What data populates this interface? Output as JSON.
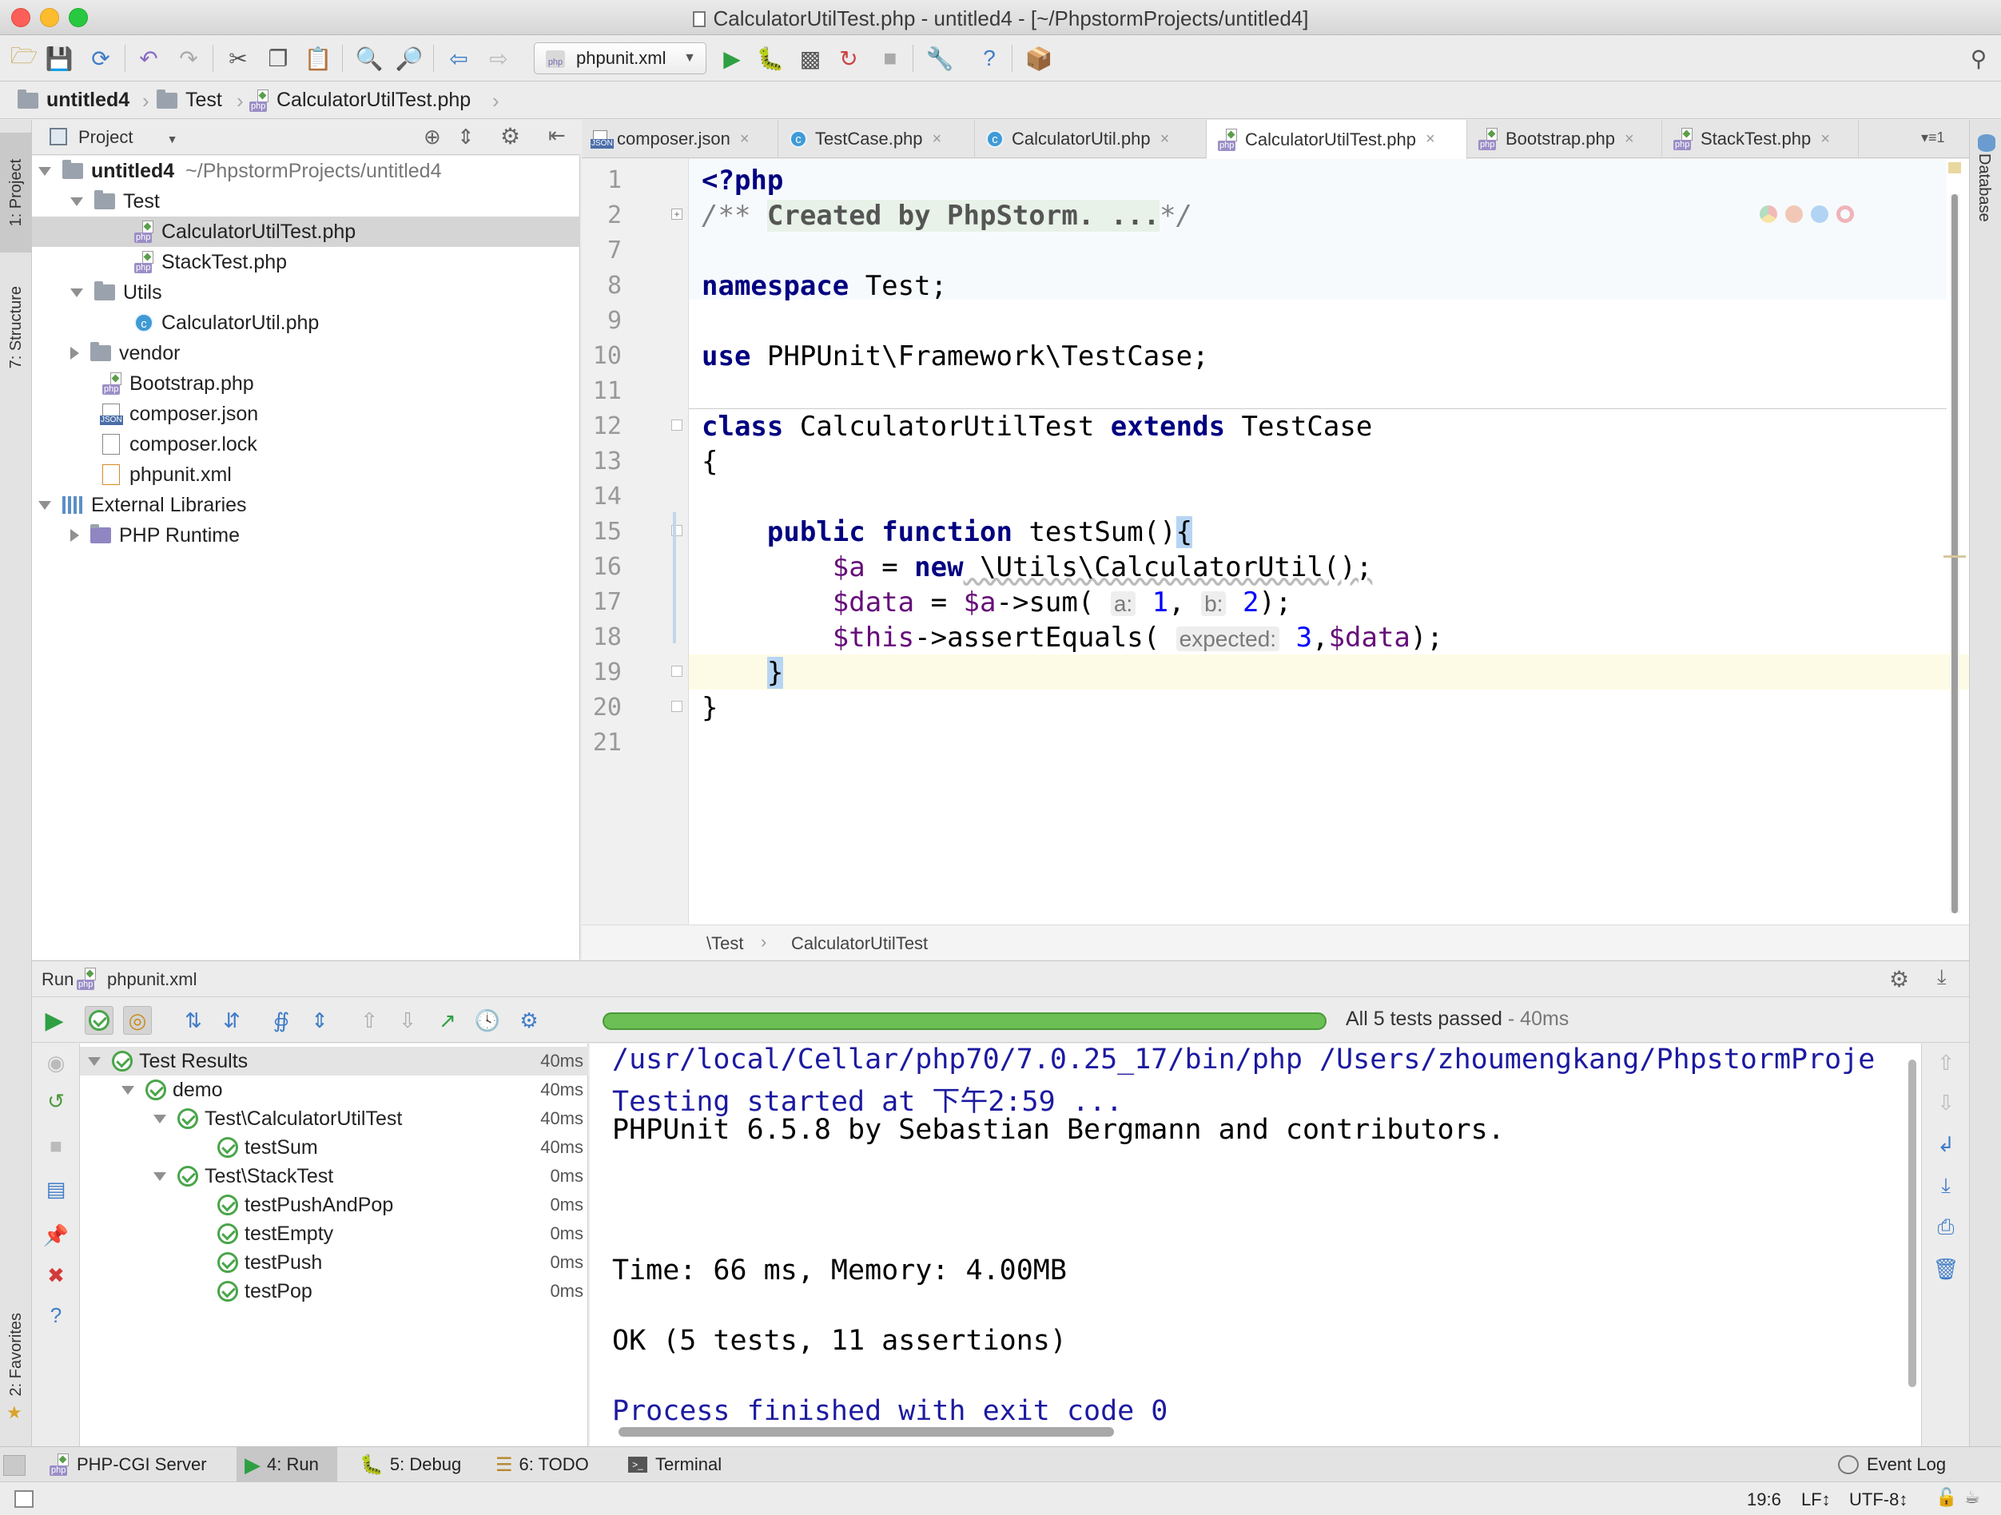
{
  "window": {
    "title": "CalculatorUtilTest.php - untitled4 - [~/PhpstormProjects/untitled4]"
  },
  "toolbar": {
    "run_config": "phpunit.xml"
  },
  "breadcrumbs": [
    "untitled4",
    "Test",
    "CalculatorUtilTest.php"
  ],
  "left_tool_tabs": [
    "1: Project",
    "7: Structure",
    "2: Favorites"
  ],
  "right_tool_tabs": [
    "Database"
  ],
  "project": {
    "header": "Project",
    "tree": [
      {
        "label": "untitled4",
        "suffix": "~/PhpstormProjects/untitled4"
      },
      {
        "label": "Test"
      },
      {
        "label": "CalculatorUtilTest.php"
      },
      {
        "label": "StackTest.php"
      },
      {
        "label": "Utils"
      },
      {
        "label": "CalculatorUtil.php"
      },
      {
        "label": "vendor"
      },
      {
        "label": "Bootstrap.php"
      },
      {
        "label": "composer.json"
      },
      {
        "label": "composer.lock"
      },
      {
        "label": "phpunit.xml"
      },
      {
        "label": "External Libraries"
      },
      {
        "label": "PHP Runtime"
      }
    ]
  },
  "tabs": [
    {
      "label": "composer.json"
    },
    {
      "label": "TestCase.php"
    },
    {
      "label": "CalculatorUtil.php"
    },
    {
      "label": "CalculatorUtilTest.php"
    },
    {
      "label": "Bootstrap.php"
    },
    {
      "label": "StackTest.php"
    }
  ],
  "tabs_overflow": "1",
  "editor": {
    "line_numbers": [
      "1",
      "2",
      "7",
      "8",
      "9",
      "10",
      "11",
      "12",
      "13",
      "14",
      "15",
      "16",
      "17",
      "18",
      "19",
      "20",
      "21"
    ],
    "t": {
      "l1": "<?php",
      "l2a": "/** ",
      "l2b": "Created by PhpStorm. ...",
      "l2c": "*/",
      "namespace_kw": "namespace",
      "namespace_rest": " Test;",
      "use_kw": "use",
      "use_rest": " PHPUnit\\Framework\\TestCase;",
      "class_kw": "class",
      "class_name": " CalculatorUtilTest ",
      "extends_kw": "extends",
      "extends_rest": " TestCase",
      "brace_open": "{",
      "public_kw": "public",
      "function_kw": "function",
      "method_name": " testSum()",
      "method_brace": "{",
      "a_var": "$a",
      "a_eq": " = ",
      "new_kw": "new",
      "a_rest": " \\Utils\\CalculatorUtil();",
      "data_var": "$data",
      "data_eq": " = ",
      "data_a": "$a",
      "data_call": "->sum(",
      "hint_a": "a:",
      "val1": "1",
      "comma": ", ",
      "hint_b": "b:",
      "val2": "2",
      "close1": ");",
      "this_var": "$this",
      "assert_call": "->assertEquals(",
      "hint_expected": "expected:",
      "val3": "3",
      "comma2": ",",
      "data_var2": "$data",
      "close2": ");",
      "method_close": "}",
      "class_close": "}"
    },
    "footer": {
      "namespace": "\\Test",
      "class": "CalculatorUtilTest"
    }
  },
  "run": {
    "label": "Run",
    "config": "phpunit.xml",
    "status": "All 5 tests passed",
    "status_time": "- 40ms",
    "progress": 1.0,
    "results": [
      {
        "label": "Test Results",
        "time": "40ms"
      },
      {
        "label": "demo",
        "time": "40ms"
      },
      {
        "label": "Test\\CalculatorUtilTest",
        "time": "40ms"
      },
      {
        "label": "testSum",
        "time": "40ms"
      },
      {
        "label": "Test\\StackTest",
        "time": "0ms"
      },
      {
        "label": "testPushAndPop",
        "time": "0ms"
      },
      {
        "label": "testEmpty",
        "time": "0ms"
      },
      {
        "label": "testPush",
        "time": "0ms"
      },
      {
        "label": "testPop",
        "time": "0ms"
      }
    ],
    "console": [
      "/usr/local/Cellar/php70/7.0.25_17/bin/php /Users/zhoumengkang/PhpstormProje",
      "Testing started at 下午2:59 ...",
      "PHPUnit 6.5.8 by Sebastian Bergmann and contributors.",
      "Time: 66 ms, Memory: 4.00MB",
      "OK (5 tests, 11 assertions)",
      "Process finished with exit code 0"
    ]
  },
  "bottom_tabs": {
    "server": "PHP-CGI Server",
    "run": "4: Run",
    "debug": "5: Debug",
    "todo": "6: TODO",
    "terminal": "Terminal",
    "event_log": "Event Log"
  },
  "status": {
    "position": "19:6",
    "line_sep": "LF↕",
    "encoding": "UTF-8↕"
  }
}
